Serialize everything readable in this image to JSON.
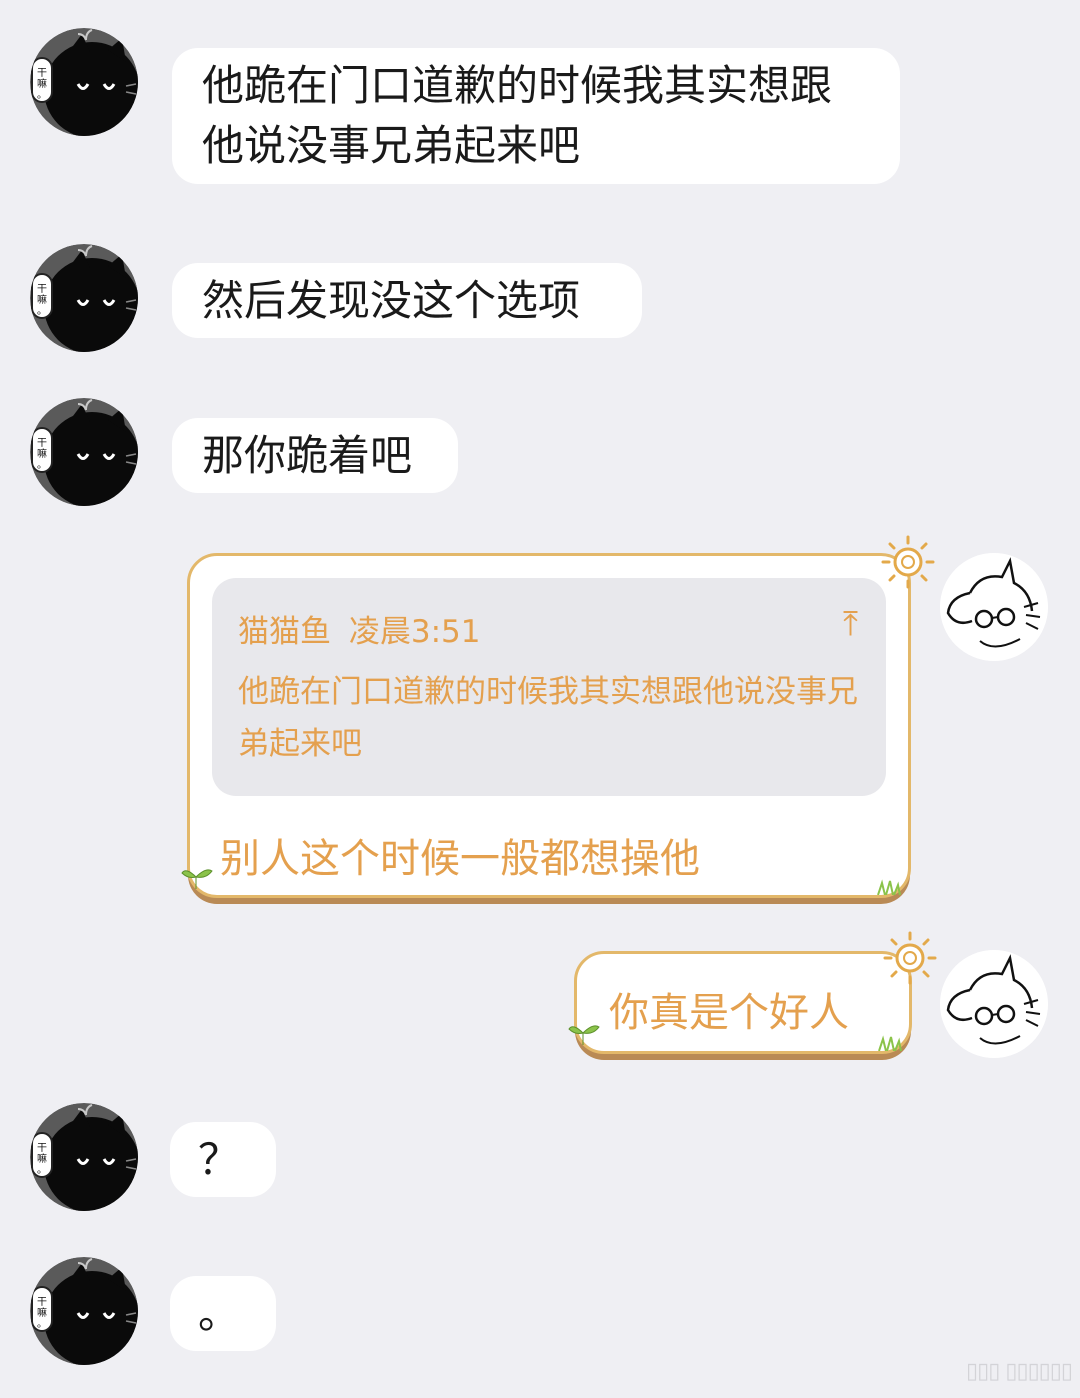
{
  "messages": [
    {
      "sender": "cat",
      "text": "他跪在门口道歉的时候我其实想跟他说没事兄弟起来吧"
    },
    {
      "sender": "cat",
      "text": "然后发现没这个选项"
    },
    {
      "sender": "cat",
      "text": "那你跪着吧"
    },
    {
      "sender": "me",
      "quote": {
        "name": "猫猫鱼",
        "time": "凌晨3:51",
        "text": "他跪在门口道歉的时候我其实想跟他说没事兄弟起来吧"
      },
      "text": "别人这个时候一般都想操他"
    },
    {
      "sender": "me",
      "text": "你真是个好人"
    },
    {
      "sender": "cat",
      "text": "？"
    },
    {
      "sender": "cat",
      "text": "。"
    }
  ],
  "avatars": {
    "cat_badge": "干嘛。"
  },
  "watermark": "▯▯▯ ▯▯▯▯▯▯",
  "colors": {
    "background": "#efeff3",
    "accent": "#e4a04e",
    "bubble_border": "#e3b86a"
  }
}
